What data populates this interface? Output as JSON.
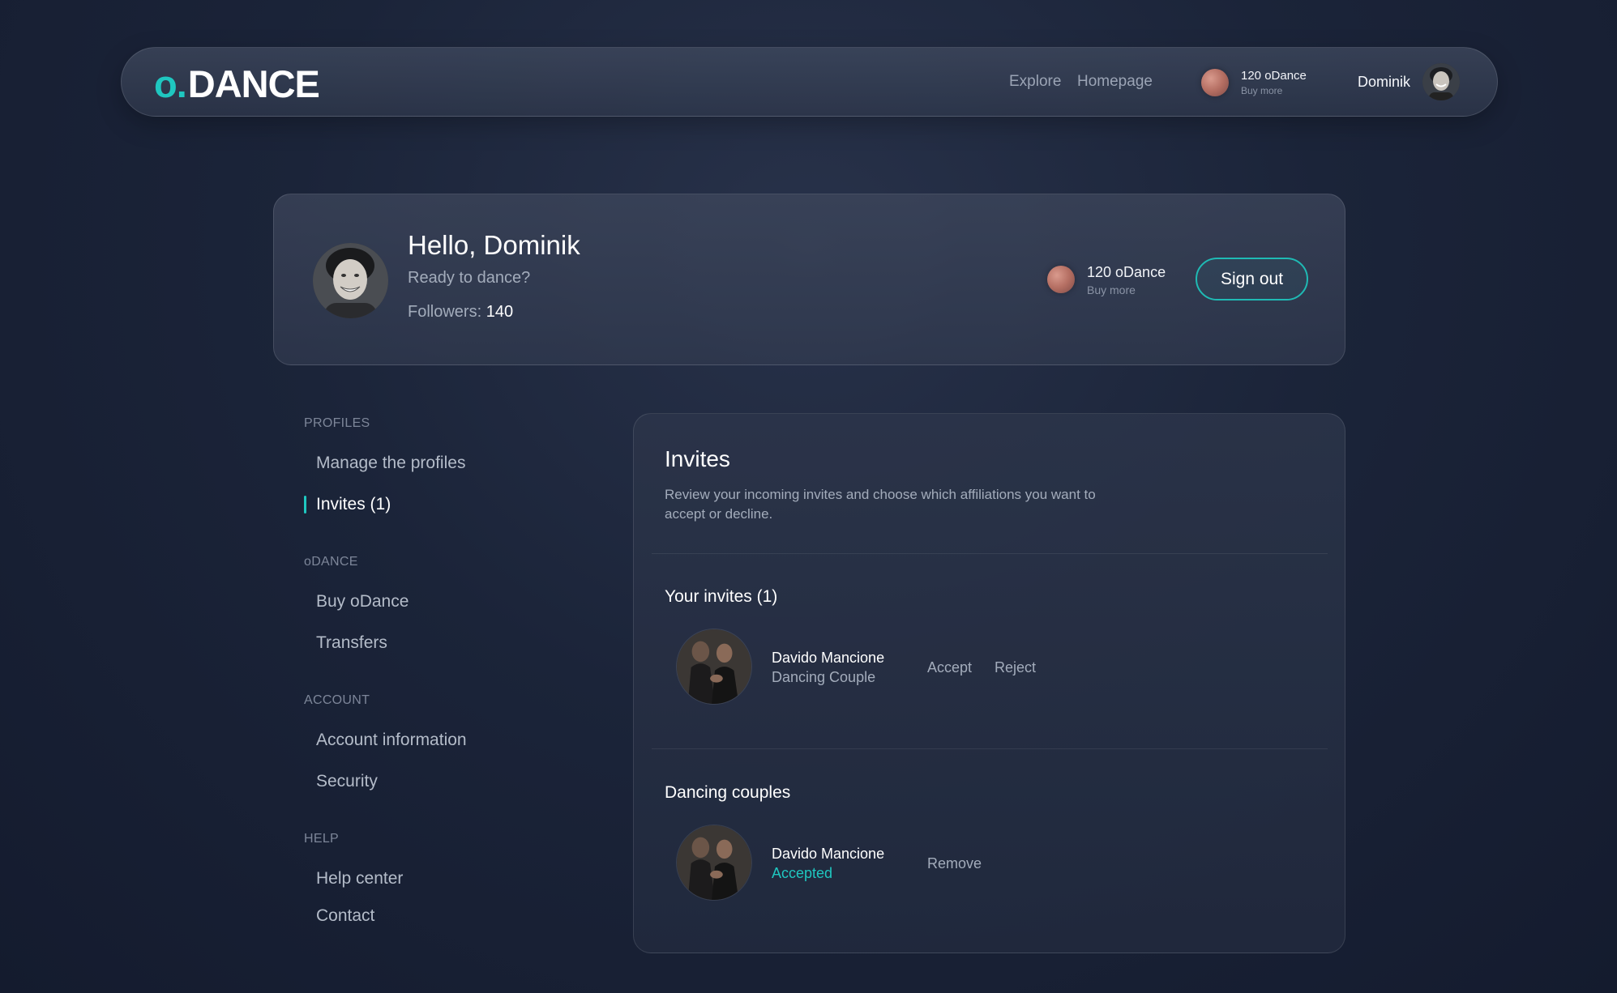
{
  "header": {
    "logo": {
      "o": "o",
      "dot": ".",
      "text": "DANCE"
    },
    "nav": [
      {
        "label": "Explore"
      },
      {
        "label": "Homepage"
      }
    ],
    "balance": {
      "amount": "120 oDance",
      "buy_more": "Buy more"
    },
    "user": {
      "name": "Dominik"
    }
  },
  "profile": {
    "greeting": "Hello, Dominik",
    "tagline": "Ready to dance?",
    "followers_label": "Followers:",
    "followers_count": "140",
    "balance": {
      "amount": "120 oDance",
      "buy_more": "Buy more"
    },
    "sign_out": "Sign out"
  },
  "sidebar": {
    "sections": [
      {
        "heading": "PROFILES",
        "items": [
          "Manage the profiles",
          "Invites (1)"
        ]
      },
      {
        "heading": "oDANCE",
        "items": [
          "Buy oDance",
          "Transfers"
        ]
      },
      {
        "heading": "ACCOUNT",
        "items": [
          "Account information",
          "Security"
        ]
      },
      {
        "heading": "HELP",
        "items": [
          "Help center",
          "Contact"
        ]
      }
    ],
    "active_item": "Invites (1)"
  },
  "invites": {
    "title": "Invites",
    "description": "Review your incoming invites and choose which affiliations you want to accept or decline.",
    "your_invites": {
      "title": "Your invites (1)",
      "items": [
        {
          "name": "Davido Mancione",
          "subtitle": "Dancing Couple",
          "accept": "Accept",
          "reject": "Reject"
        }
      ]
    },
    "dancing_couples": {
      "title": "Dancing couples",
      "items": [
        {
          "name": "Davido Mancione",
          "status": "Accepted",
          "remove": "Remove"
        }
      ]
    }
  },
  "colors": {
    "accent": "#1fc7c0",
    "background": "#1b2439",
    "coin": "#b46e62"
  }
}
